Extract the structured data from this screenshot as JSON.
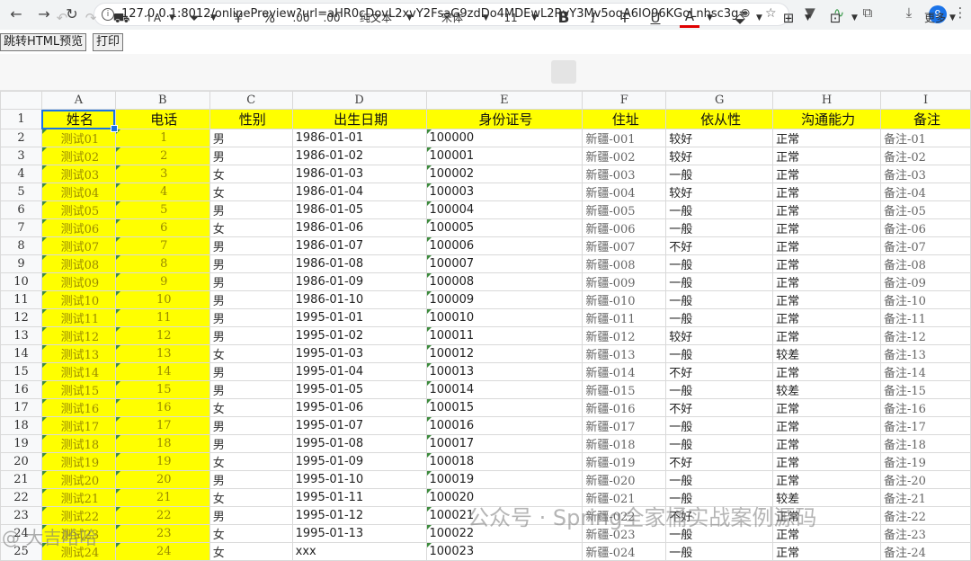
{
  "browser": {
    "url": "127.0.0.1:8012/onlinePreview?url=aHR0cDovL2xvY2FsaG9zdDo4MDEwL2RvY3Mv5oqA6IO96KGoLnhsc3g=",
    "profile_badge": "9"
  },
  "preview": {
    "html_button": "跳转HTML预览",
    "print_button": "打印"
  },
  "toolbar": {
    "currency": "¥",
    "percent": "%",
    "dec_dec": ".00",
    "dec_inc": ".00",
    "number_format": "纯文本",
    "font_name": "宋体",
    "font_size": "11",
    "bold": "B",
    "italic": "I",
    "strike": "T",
    "underline": "U",
    "font_color": "A",
    "more": "更多"
  },
  "columns": [
    "A",
    "B",
    "C",
    "D",
    "E",
    "F",
    "G",
    "H",
    "I"
  ],
  "header_row": [
    "姓名",
    "电话",
    "性别",
    "出生日期",
    "身份证号",
    "住址",
    "依从性",
    "沟通能力",
    "备注"
  ],
  "rows": [
    {
      "n": "2",
      "name": "测试01",
      "phone": "1",
      "sex": "男",
      "dob": "1986-01-01",
      "id": "100000",
      "addr": "新疆-001",
      "comp": "较好",
      "comm": "正常",
      "note": "备注-01"
    },
    {
      "n": "3",
      "name": "测试02",
      "phone": "2",
      "sex": "男",
      "dob": "1986-01-02",
      "id": "100001",
      "addr": "新疆-002",
      "comp": "较好",
      "comm": "正常",
      "note": "备注-02"
    },
    {
      "n": "4",
      "name": "测试03",
      "phone": "3",
      "sex": "女",
      "dob": "1986-01-03",
      "id": "100002",
      "addr": "新疆-003",
      "comp": "一般",
      "comm": "正常",
      "note": "备注-03"
    },
    {
      "n": "5",
      "name": "测试04",
      "phone": "4",
      "sex": "女",
      "dob": "1986-01-04",
      "id": "100003",
      "addr": "新疆-004",
      "comp": "较好",
      "comm": "正常",
      "note": "备注-04"
    },
    {
      "n": "6",
      "name": "测试05",
      "phone": "5",
      "sex": "男",
      "dob": "1986-01-05",
      "id": "100004",
      "addr": "新疆-005",
      "comp": "一般",
      "comm": "正常",
      "note": "备注-05"
    },
    {
      "n": "7",
      "name": "测试06",
      "phone": "6",
      "sex": "女",
      "dob": "1986-01-06",
      "id": "100005",
      "addr": "新疆-006",
      "comp": "一般",
      "comm": "正常",
      "note": "备注-06"
    },
    {
      "n": "8",
      "name": "测试07",
      "phone": "7",
      "sex": "男",
      "dob": "1986-01-07",
      "id": "100006",
      "addr": "新疆-007",
      "comp": "不好",
      "comm": "正常",
      "note": "备注-07"
    },
    {
      "n": "9",
      "name": "测试08",
      "phone": "8",
      "sex": "男",
      "dob": "1986-01-08",
      "id": "100007",
      "addr": "新疆-008",
      "comp": "一般",
      "comm": "正常",
      "note": "备注-08"
    },
    {
      "n": "10",
      "name": "测试09",
      "phone": "9",
      "sex": "男",
      "dob": "1986-01-09",
      "id": "100008",
      "addr": "新疆-009",
      "comp": "一般",
      "comm": "正常",
      "note": "备注-09"
    },
    {
      "n": "11",
      "name": "测试10",
      "phone": "10",
      "sex": "男",
      "dob": "1986-01-10",
      "id": "100009",
      "addr": "新疆-010",
      "comp": "一般",
      "comm": "正常",
      "note": "备注-10"
    },
    {
      "n": "12",
      "name": "测试11",
      "phone": "11",
      "sex": "男",
      "dob": "1995-01-01",
      "id": "100010",
      "addr": "新疆-011",
      "comp": "一般",
      "comm": "正常",
      "note": "备注-11"
    },
    {
      "n": "13",
      "name": "测试12",
      "phone": "12",
      "sex": "男",
      "dob": "1995-01-02",
      "id": "100011",
      "addr": "新疆-012",
      "comp": "较好",
      "comm": "正常",
      "note": "备注-12"
    },
    {
      "n": "14",
      "name": "测试13",
      "phone": "13",
      "sex": "女",
      "dob": "1995-01-03",
      "id": "100012",
      "addr": "新疆-013",
      "comp": "一般",
      "comm": "较差",
      "note": "备注-13"
    },
    {
      "n": "15",
      "name": "测试14",
      "phone": "14",
      "sex": "男",
      "dob": "1995-01-04",
      "id": "100013",
      "addr": "新疆-014",
      "comp": "不好",
      "comm": "正常",
      "note": "备注-14"
    },
    {
      "n": "16",
      "name": "测试15",
      "phone": "15",
      "sex": "男",
      "dob": "1995-01-05",
      "id": "100014",
      "addr": "新疆-015",
      "comp": "一般",
      "comm": "较差",
      "note": "备注-15"
    },
    {
      "n": "17",
      "name": "测试16",
      "phone": "16",
      "sex": "女",
      "dob": "1995-01-06",
      "id": "100015",
      "addr": "新疆-016",
      "comp": "不好",
      "comm": "正常",
      "note": "备注-16"
    },
    {
      "n": "18",
      "name": "测试17",
      "phone": "17",
      "sex": "男",
      "dob": "1995-01-07",
      "id": "100016",
      "addr": "新疆-017",
      "comp": "一般",
      "comm": "正常",
      "note": "备注-17"
    },
    {
      "n": "19",
      "name": "测试18",
      "phone": "18",
      "sex": "男",
      "dob": "1995-01-08",
      "id": "100017",
      "addr": "新疆-018",
      "comp": "一般",
      "comm": "正常",
      "note": "备注-18"
    },
    {
      "n": "20",
      "name": "测试19",
      "phone": "19",
      "sex": "女",
      "dob": "1995-01-09",
      "id": "100018",
      "addr": "新疆-019",
      "comp": "不好",
      "comm": "正常",
      "note": "备注-19"
    },
    {
      "n": "21",
      "name": "测试20",
      "phone": "20",
      "sex": "男",
      "dob": "1995-01-10",
      "id": "100019",
      "addr": "新疆-020",
      "comp": "一般",
      "comm": "正常",
      "note": "备注-20"
    },
    {
      "n": "22",
      "name": "测试21",
      "phone": "21",
      "sex": "女",
      "dob": "1995-01-11",
      "id": "100020",
      "addr": "新疆-021",
      "comp": "一般",
      "comm": "较差",
      "note": "备注-21"
    },
    {
      "n": "23",
      "name": "测试22",
      "phone": "22",
      "sex": "男",
      "dob": "1995-01-12",
      "id": "100021",
      "addr": "新疆-022",
      "comp": "不好",
      "comm": "正常",
      "note": "备注-22"
    },
    {
      "n": "24",
      "name": "测试23",
      "phone": "23",
      "sex": "女",
      "dob": "1995-01-13",
      "id": "100022",
      "addr": "新疆-023",
      "comp": "一般",
      "comm": "正常",
      "note": "备注-23"
    },
    {
      "n": "25",
      "name": "测试24",
      "phone": "24",
      "sex": "女",
      "dob": "xxx",
      "id": "100023",
      "addr": "新疆-024",
      "comp": "一般",
      "comm": "正常",
      "note": "备注-24"
    }
  ],
  "watermark": {
    "text": "公众号 · Spring全家桶实战案例源码",
    "corner": "@ 大吉哈哈"
  },
  "colors": {
    "header_fill": "#ffff00",
    "selection": "#1a73e8"
  }
}
